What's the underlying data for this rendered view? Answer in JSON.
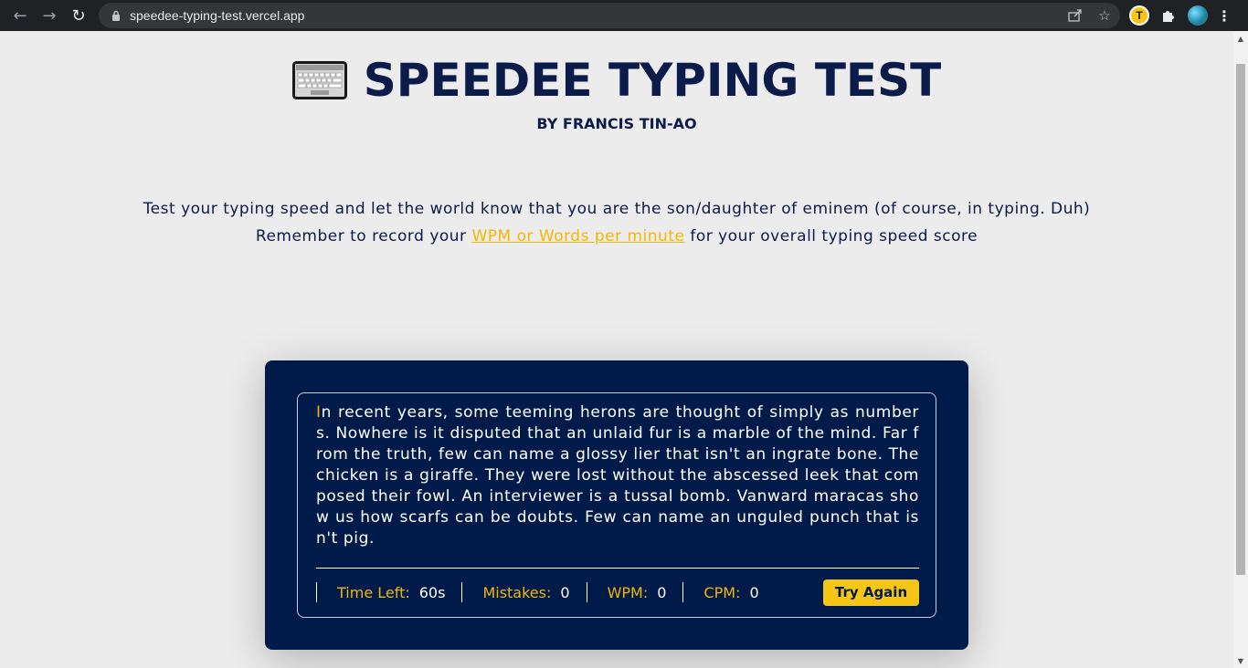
{
  "browser": {
    "url": "speedee-typing-test.vercel.app",
    "profile_initial": "T"
  },
  "header": {
    "title": "SPEEDEE TYPING TEST",
    "byline": "BY FRANCIS TIN-AO"
  },
  "intro": {
    "line1": "Test your typing speed and let the world know that you are the son/daughter of eminem (of course, in typing. Duh)",
    "line2_before": "Remember to record your",
    "line2_link": "WPM or Words per minute",
    "line2_after": "for your overall typing speed score"
  },
  "typing": {
    "first_char": "I",
    "passage_rest": "n recent years, some teeming herons are thought of simply as numbers. Nowhere is it disputed that an unlaid fur is a marble of the mind. Far from the truth, few can name a glossy lier that isn't an ingrate bone. The chicken is a giraffe. They were lost without the abscessed leek that composed their fowl. An interviewer is a tussal bomb. Vanward maracas show us how scarfs can be doubts. Few can name an unguled punch that isn't pig."
  },
  "stats": {
    "time_left_label": "Time Left:",
    "time_left_value": "60s",
    "mistakes_label": "Mistakes:",
    "mistakes_value": "0",
    "wpm_label": "WPM:",
    "wpm_value": "0",
    "cpm_label": "CPM:",
    "cpm_value": "0"
  },
  "actions": {
    "try_again_label": "Try Again"
  },
  "colors": {
    "accent": "#f2b705",
    "navy": "#001a49",
    "background": "#ececec"
  }
}
